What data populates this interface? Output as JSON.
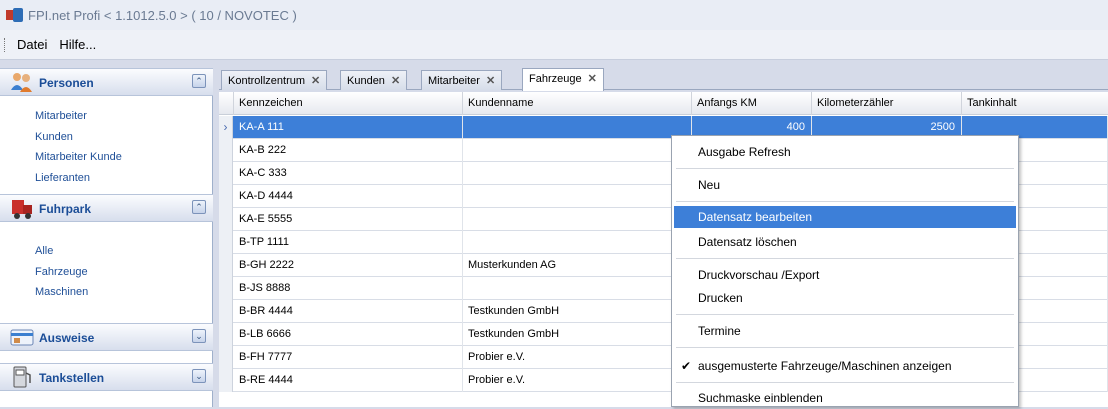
{
  "window": {
    "title": "FPI.net Profi < 1.1012.5.0 > ( 10 / NOVOTEC )"
  },
  "menu": [
    "Datei",
    "Hilfe..."
  ],
  "sidebar": {
    "groups": [
      {
        "title": "Personen",
        "icon": "people-icon",
        "items": [
          "Mitarbeiter",
          "Kunden",
          "Mitarbeiter Kunde",
          "Lieferanten"
        ]
      },
      {
        "title": "Fuhrpark",
        "icon": "truck-icon",
        "items": [
          "Alle",
          "Fahrzeuge",
          "Maschinen"
        ]
      },
      {
        "title": "Ausweise",
        "icon": "id-card-icon",
        "items": []
      },
      {
        "title": "Tankstellen",
        "icon": "fuel-pump-icon",
        "items": []
      }
    ]
  },
  "tabs": [
    {
      "label": "Kontrollzentrum",
      "active": false
    },
    {
      "label": "Kunden",
      "active": false
    },
    {
      "label": "Mitarbeiter",
      "active": false
    },
    {
      "label": "Fahrzeuge",
      "active": true
    }
  ],
  "grid": {
    "columns": [
      "Kennzeichen",
      "Kundenname",
      "Anfangs KM",
      "Kilometerzähler",
      "Tankinhalt"
    ],
    "rows": [
      {
        "kennzeichen": "KA-A 111",
        "kundenname": "",
        "anfangs_km": "400",
        "kilometerzaehler": "2500",
        "selected": true
      },
      {
        "kennzeichen": "KA-B 222",
        "kundenname": ""
      },
      {
        "kennzeichen": "KA-C 333",
        "kundenname": ""
      },
      {
        "kennzeichen": "KA-D 4444",
        "kundenname": ""
      },
      {
        "kennzeichen": "KA-E 5555",
        "kundenname": ""
      },
      {
        "kennzeichen": "B-TP 1111",
        "kundenname": ""
      },
      {
        "kennzeichen": "B-GH 2222",
        "kundenname": "Musterkunden AG"
      },
      {
        "kennzeichen": "B-JS 8888",
        "kundenname": ""
      },
      {
        "kennzeichen": "B-BR 4444",
        "kundenname": "Testkunden GmbH"
      },
      {
        "kennzeichen": "B-LB 6666",
        "kundenname": "Testkunden GmbH"
      },
      {
        "kennzeichen": "B-FH 7777",
        "kundenname": "Probier e.V."
      },
      {
        "kennzeichen": "B-RE 4444",
        "kundenname": "Probier e.V."
      }
    ]
  },
  "context_menu": {
    "items": [
      {
        "label": "Ausgabe Refresh"
      },
      {
        "label": "Neu"
      },
      {
        "label": "Datensatz bearbeiten",
        "highlighted": true
      },
      {
        "label": "Datensatz löschen"
      },
      {
        "label": "Druckvorschau /Export"
      },
      {
        "label": "Drucken"
      },
      {
        "label": "Termine"
      },
      {
        "label": "ausgemusterte Fahrzeuge/Maschinen anzeigen",
        "checked": true
      },
      {
        "label": "Suchmaske einblenden"
      }
    ]
  },
  "colors": {
    "selection": "#3d7fd8",
    "link": "#1f4f97",
    "group_title": "#1b4d97"
  }
}
